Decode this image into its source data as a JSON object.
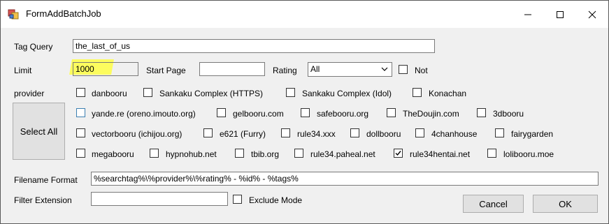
{
  "window": {
    "title": "FormAddBatchJob",
    "icon": "form-app-icon"
  },
  "labels": {
    "tag_query": "Tag Query",
    "limit": "Limit",
    "start_page": "Start Page",
    "rating": "Rating",
    "provider": "provider",
    "filename_format": "Filename Format",
    "filter_extension": "Filter Extension"
  },
  "fields": {
    "tag_query": "the_last_of_us",
    "limit": "1000",
    "start_page": "",
    "rating": "All",
    "filename_format": "%searchtag%\\%provider%\\%rating% - %id% - %tags%",
    "filter_extension": ""
  },
  "not_checkbox": {
    "label": "Not",
    "checked": false
  },
  "exclude_mode": {
    "label": "Exclude Mode",
    "checked": false
  },
  "select_all_label": "Select All",
  "providers": [
    {
      "label": "danbooru",
      "checked": false
    },
    {
      "label": "Sankaku Complex (HTTPS)",
      "checked": false
    },
    {
      "label": "Sankaku Complex (Idol)",
      "checked": false
    },
    {
      "label": "Konachan",
      "checked": false
    },
    {
      "label": "yande.re (oreno.imouto.org)",
      "checked": false
    },
    {
      "label": "gelbooru.com",
      "checked": false
    },
    {
      "label": "safebooru.org",
      "checked": false
    },
    {
      "label": "TheDoujin.com",
      "checked": false
    },
    {
      "label": "3dbooru",
      "checked": false
    },
    {
      "label": "vectorbooru (ichijou.org)",
      "checked": false
    },
    {
      "label": "e621 (Furry)",
      "checked": false
    },
    {
      "label": "rule34.xxx",
      "checked": false
    },
    {
      "label": "dollbooru",
      "checked": false
    },
    {
      "label": "4chanhouse",
      "checked": false
    },
    {
      "label": "fairygarden",
      "checked": false
    },
    {
      "label": "megabooru",
      "checked": false
    },
    {
      "label": "hypnohub.net",
      "checked": false
    },
    {
      "label": "tbib.org",
      "checked": false
    },
    {
      "label": "rule34.paheal.net",
      "checked": false
    },
    {
      "label": "rule34hentai.net",
      "checked": true
    },
    {
      "label": "lolibooru.moe",
      "checked": false
    }
  ],
  "buttons": {
    "cancel": "Cancel",
    "ok": "OK"
  }
}
